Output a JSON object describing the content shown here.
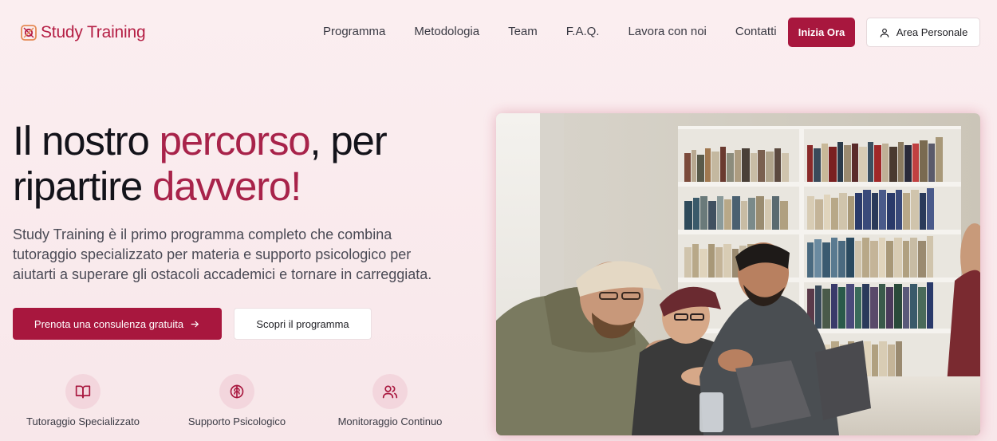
{
  "brand": {
    "name": "Study Training"
  },
  "nav": {
    "items": [
      "Programma",
      "Metodologia",
      "Team",
      "F.A.Q.",
      "Lavora con noi",
      "Contatti"
    ],
    "cta_label": "Inizia Ora",
    "area_label": "Area Personale"
  },
  "hero": {
    "title_part1": "Il nostro ",
    "title_accent1": "percorso",
    "title_part2": ", per",
    "title_part3": "ripartire ",
    "title_accent2": "davvero!",
    "description": "Study Training è il primo programma completo che combina tutoraggio specializzato per materia e supporto psicologico per aiutarti a superare gli ostacoli accademici e tornare in carreggiata.",
    "primary_button": "Prenota una consulenza gratuita",
    "secondary_button": "Scopri il programma"
  },
  "features": [
    {
      "label": "Tutoraggio Specializzato",
      "icon": "book-open-icon"
    },
    {
      "label": "Supporto Psicologico",
      "icon": "brain-icon"
    },
    {
      "label": "Monitoraggio Continuo",
      "icon": "users-icon"
    }
  ],
  "colors": {
    "accent": "#a8173e",
    "title_accent": "#a8234a",
    "background": "#f9eaed",
    "icon_bg": "#f3d6dd"
  },
  "image": {
    "subject": "students-studying-in-library-photo"
  }
}
